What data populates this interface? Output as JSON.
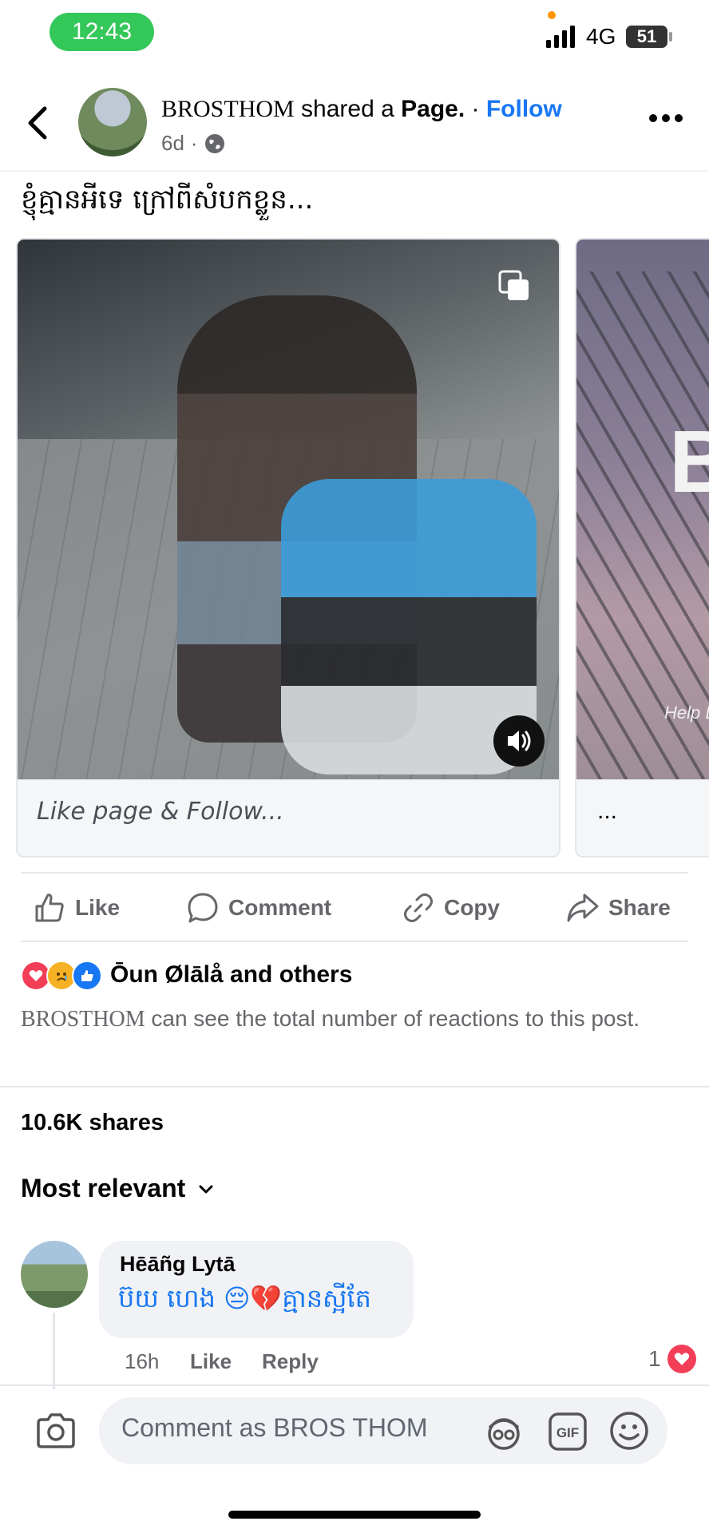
{
  "status_bar": {
    "time": "12:43",
    "network": "4G",
    "battery": "51"
  },
  "header": {
    "author": "BROSTHOM",
    "shared_text": " shared a ",
    "page_label": "Page.",
    "separator": " · ",
    "follow_label": "Follow",
    "age": "6d",
    "age_sep": "·"
  },
  "post": {
    "caption": "ខ្ញុំគ្មានអីទេ ក្រៅពីសំបកខ្លួន...",
    "cards": [
      {
        "footer": "Like page & Follow..."
      },
      {
        "footer": "...",
        "overlay_letter": "B",
        "overlay_text": "Help L"
      }
    ]
  },
  "actions": {
    "like": "Like",
    "comment": "Comment",
    "copy": "Copy",
    "share": "Share"
  },
  "reactions": {
    "names": "Ōun Ølālå and others",
    "note_name": "BROSTHOM",
    "note_text": " can see the total number of reactions to this post."
  },
  "shares": "10.6K shares",
  "sort_label": "Most relevant",
  "comment": {
    "author": "Hēāñg Lytā",
    "text": "ប៊យ ហេង  😔💔គ្មានស្អីតែ",
    "time": "16h",
    "like": "Like",
    "reply": "Reply",
    "reaction_count": "1"
  },
  "composer": {
    "placeholder": "Comment as BROS THOM"
  },
  "colors": {
    "accent": "#1877f2",
    "love": "#f33e58",
    "status_pill": "#34c759"
  }
}
